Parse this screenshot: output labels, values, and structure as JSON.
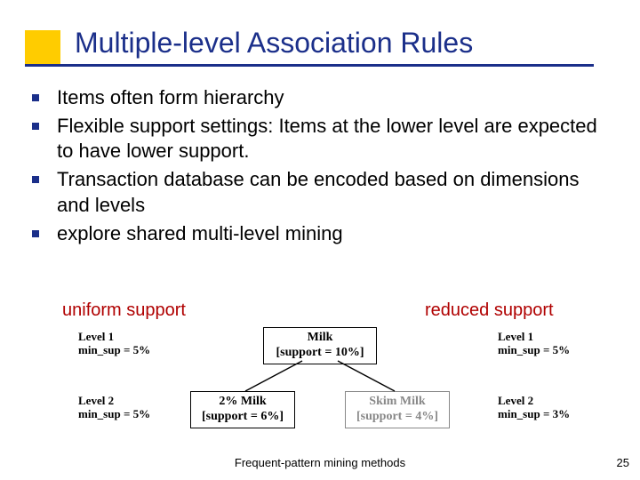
{
  "title": "Multiple-level Association Rules",
  "bullets": [
    "Items often form hierarchy",
    "Flexible support settings: Items at the lower level are expected to have lower support.",
    "Transaction database can be encoded based on dimensions and levels",
    "explore shared multi-level mining"
  ],
  "support": {
    "uniform": "uniform support",
    "reduced": "reduced support"
  },
  "left_labels": {
    "l1_line1": "Level 1",
    "l1_line2": "min_sup = 5%",
    "l2_line1": "Level 2",
    "l2_line2": "min_sup = 5%"
  },
  "right_labels": {
    "l1_line1": "Level 1",
    "l1_line2": "min_sup = 5%",
    "l2_line1": "Level 2",
    "l2_line2": "min_sup = 3%"
  },
  "boxes": {
    "milk_line1": "Milk",
    "milk_line2": "[support = 10%]",
    "twop_line1": "2% Milk",
    "twop_line2": "[support = 6%]",
    "skim_line1": "Skim Milk",
    "skim_line2": "[support = 4%]"
  },
  "footer": "Frequent-pattern mining methods",
  "page": "25",
  "chart_data": {
    "type": "table",
    "title": "Multi-level support example",
    "hierarchy": {
      "parent": {
        "name": "Milk",
        "support_pct": 10
      },
      "children": [
        {
          "name": "2% Milk",
          "support_pct": 6
        },
        {
          "name": "Skim Milk",
          "support_pct": 4
        }
      ]
    },
    "uniform_support": {
      "level1_min_sup_pct": 5,
      "level2_min_sup_pct": 5
    },
    "reduced_support": {
      "level1_min_sup_pct": 5,
      "level2_min_sup_pct": 3
    }
  }
}
